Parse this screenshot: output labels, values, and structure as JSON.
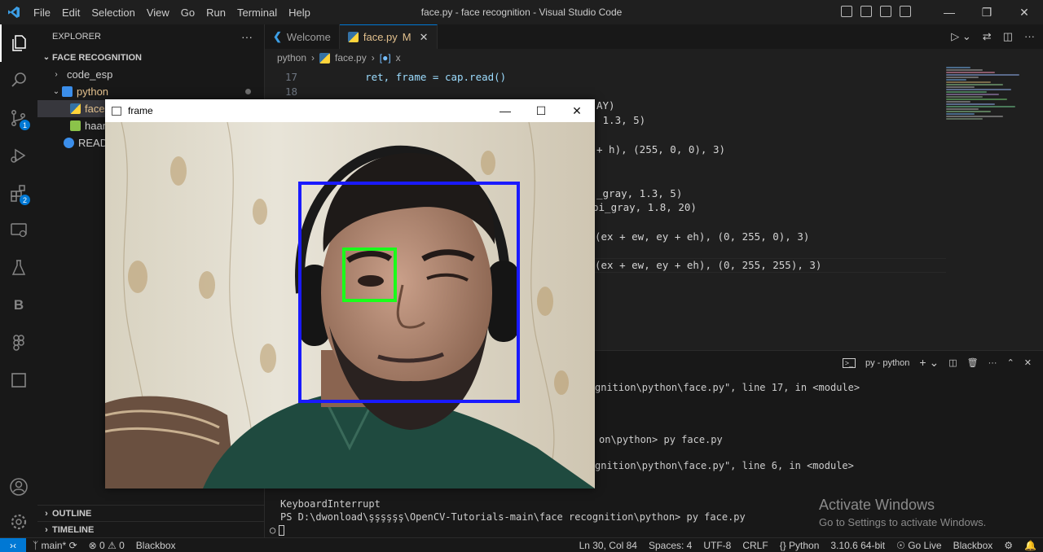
{
  "window": {
    "title": "face.py - face recognition - Visual Studio Code",
    "menu": [
      "File",
      "Edit",
      "Selection",
      "View",
      "Go",
      "Run",
      "Terminal",
      "Help"
    ]
  },
  "activity": {
    "scm_badge": "1",
    "extensions_badge": "2"
  },
  "sidebar": {
    "header": "EXPLORER",
    "more": "···",
    "root": "FACE RECOGNITION",
    "items": [
      {
        "label": "code_esp",
        "icon": "folder-collapsed-icon"
      },
      {
        "label": "python",
        "icon": "folder-open-icon"
      },
      {
        "label": "face",
        "icon": "python-file-icon"
      },
      {
        "label": "haar",
        "icon": "xml-file-icon"
      },
      {
        "label": "READ",
        "icon": "info-icon"
      }
    ],
    "outline": "OUTLINE",
    "timeline": "TIMELINE"
  },
  "tabs": [
    {
      "label": "Welcome"
    },
    {
      "label": "face.py",
      "modified": "M",
      "close": "✕"
    }
  ],
  "breadcrumb": [
    "python",
    "face.py",
    "x"
  ],
  "editor": {
    "line_numbers": [
      "17",
      "18"
    ],
    "lines": [
      {
        "prefix": "    ",
        "text": "ret, frame = cap.read()"
      },
      {
        "prefix": "",
        "text": "AY)"
      },
      {
        "prefix": "",
        "text": " 1.3, 5)"
      },
      {
        "prefix": "",
        "text": "+ h), (255, 0, 0), 3)"
      },
      {
        "prefix": "",
        "text": "_gray, 1.3, 5)"
      },
      {
        "prefix": "",
        "text": "pi_gray, 1.8, 20)"
      },
      {
        "prefix": "",
        "text": "(ex + ew, ey + eh), (0, 255, 0), 3)"
      },
      {
        "prefix": "",
        "text": "(ex + ew, ey + eh), (0, 255, 255), 3)"
      }
    ]
  },
  "panel": {
    "terminal_label": "py - python",
    "lines": [
      "gnition\\python\\face.py\", line 17, in <module>",
      "on\\python> py face.py",
      "gnition\\python\\face.py\", line 6, in <module>",
      "KeyboardInterrupt",
      "PS D:\\dwonload\\şşşşşş\\OpenCV-Tutorials-main\\face recognition\\python> py face.py"
    ],
    "cmd": "py face.py"
  },
  "watermark": {
    "line1": "Activate Windows",
    "line2": "Go to Settings to activate Windows."
  },
  "statusbar": {
    "branch": "main*",
    "problems": "⊗ 0 ⚠ 0",
    "blackbox_left": "Blackbox",
    "position": "Ln 30, Col 84",
    "spaces": "Spaces: 4",
    "encoding": "UTF-8",
    "eol": "CRLF",
    "language": "Python",
    "interpreter": "3.10.6 64-bit",
    "golive": "Go Live",
    "blackbox_right": "Blackbox"
  },
  "cv_window": {
    "title": "frame"
  },
  "colors": {
    "accent": "#0078d4",
    "face_box": "#1a1aff",
    "eye_box": "#1aff1a"
  }
}
